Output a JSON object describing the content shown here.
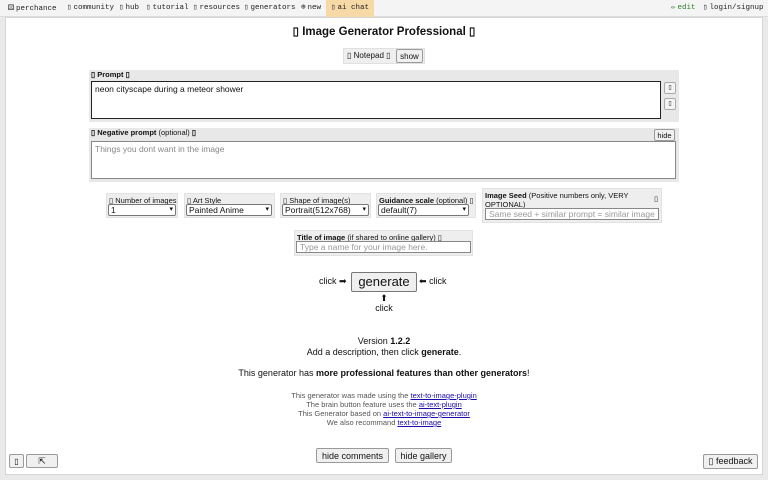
{
  "nav": {
    "perchance": "perchance",
    "community": "community",
    "hub": "hub",
    "tutorial": "tutorial",
    "resources": "resources",
    "generators": "generators",
    "new": "new",
    "ai_chat": "ai chat",
    "edit": "edit",
    "login": "login/signup"
  },
  "title": "Image Generator Professional",
  "notepad": {
    "label": "Notepad",
    "show_button": "show"
  },
  "prompt": {
    "label": "Prompt",
    "value": "neon cityscape during a meteor shower"
  },
  "negative": {
    "label": "Negative prompt",
    "optional": "(optional)",
    "placeholder": "Things you dont want in the image",
    "hide_button": "hide"
  },
  "options": {
    "num_images": {
      "label": "Number of images",
      "value": "1"
    },
    "art_style": {
      "label": "Art Style",
      "value": "Painted Anime"
    },
    "shape": {
      "label": "Shape of image(s)",
      "value": "Portrait(512x768)"
    },
    "guidance": {
      "label": "Guidance scale",
      "optional": "(optional)",
      "value": "default(7)"
    },
    "seed": {
      "label": "Image Seed",
      "note": "(Positive numbers only, VERY OPTIONAL)",
      "placeholder": "Same seed + similar prompt = similar image"
    },
    "title_of_image": {
      "label": "Title of image",
      "note": "(if shared to online gallery)",
      "placeholder": "Type a name for your image here."
    }
  },
  "generate": {
    "button": "generate",
    "click_left": "click",
    "click_right": "click",
    "click_below": "click"
  },
  "version_prefix": "Version",
  "version": "1.2.2",
  "instructions_prefix": "Add a description, then click",
  "instructions_bold": "generate",
  "tagline_prefix": "This generator has",
  "tagline_bold": "more professional features than other generators",
  "credits": {
    "line1_text": "This generator was made using the",
    "line1_link": "text-to-image-plugin",
    "line2_text": "The brain button feature uses the",
    "line2_link": "ai-text-plugin",
    "line3_text": "This Generator based on",
    "line3_link": "ai-text-to-image-generator",
    "line4_text": "We also recommand",
    "line4_link": "text-to-image"
  },
  "bottom": {
    "hide_comments": "hide comments",
    "hide_gallery": "hide gallery",
    "feedback": "feedback"
  },
  "icons": {
    "arrow_right": "➡",
    "arrow_left": "⬅",
    "arrow_up": "⬆",
    "expand": "⇱",
    "dice": "⚄",
    "plus_circle": "⊕",
    "pencil": "✏"
  }
}
